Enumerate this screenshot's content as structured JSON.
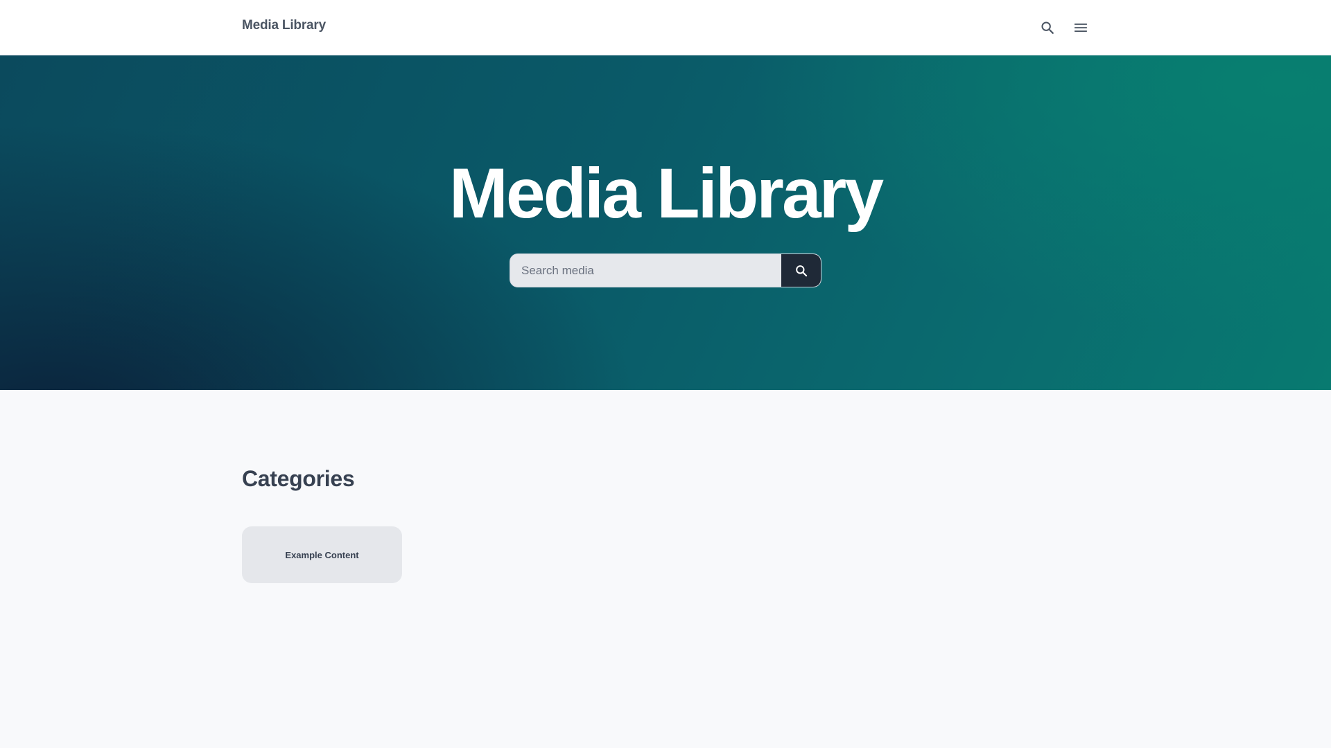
{
  "header": {
    "brand": "Media Library",
    "search_icon": "search-icon",
    "menu_icon": "hamburger-menu-icon"
  },
  "hero": {
    "title": "Media Library",
    "search": {
      "placeholder": "Search media",
      "value": "",
      "button_icon": "search-icon"
    }
  },
  "categories": {
    "title": "Categories",
    "items": [
      {
        "label": "Example Content"
      }
    ]
  },
  "colors": {
    "hero_gradient_start": "#0b2a45",
    "hero_gradient_end": "#087a70",
    "search_button": "#1f2937",
    "page_background": "#f8f9fb",
    "card_background": "#e5e7eb",
    "text_dark": "#374151"
  }
}
